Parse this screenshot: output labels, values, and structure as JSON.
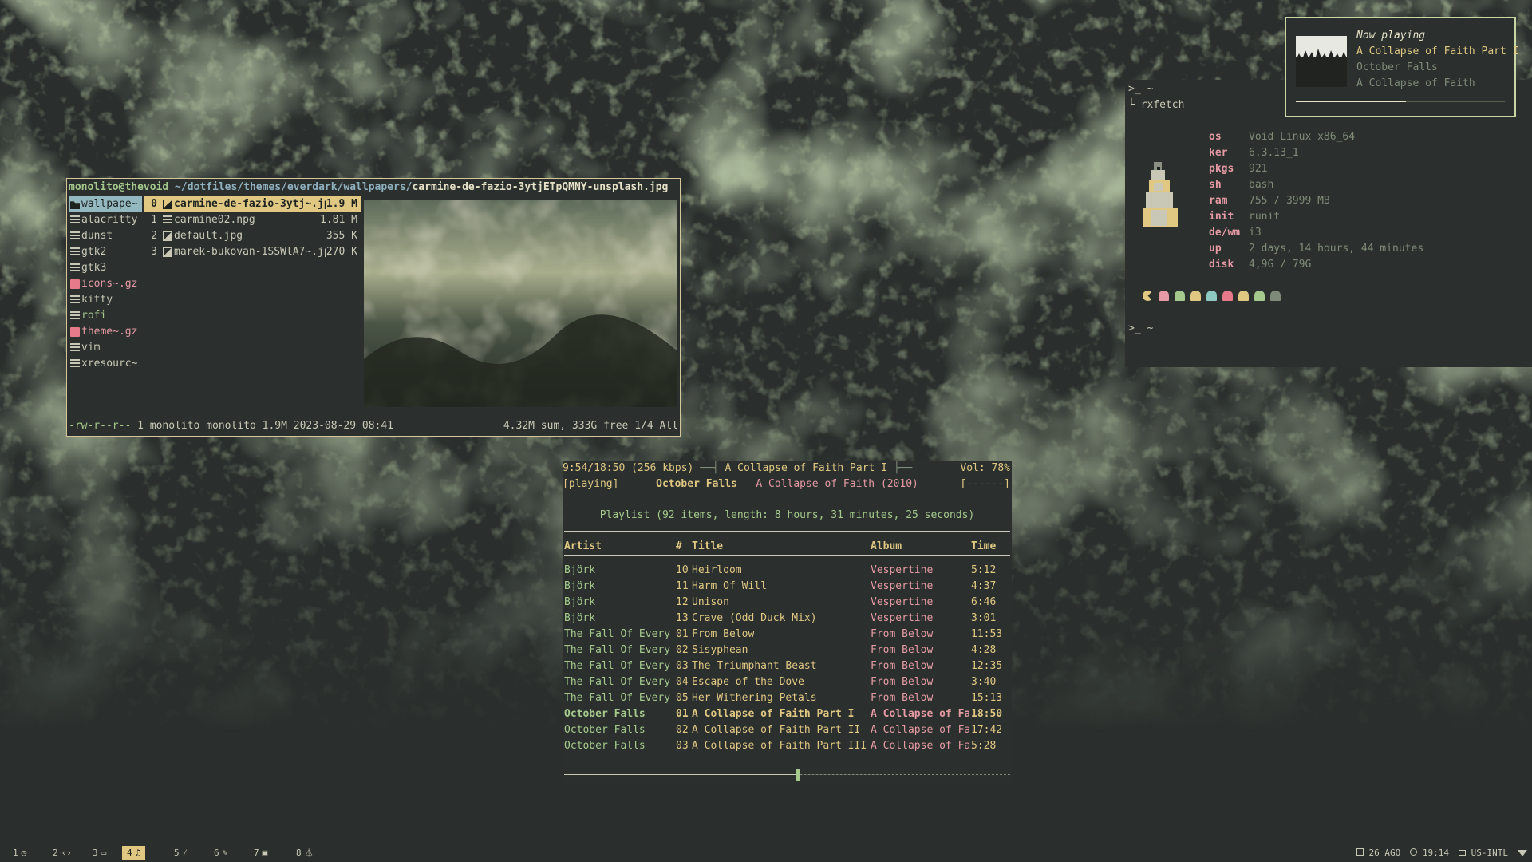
{
  "file_manager": {
    "path_user": "monolito@thevoid",
    "path_dir": " ~/dotfiles/themes/everdark/wallpapers/",
    "path_file": "carmine-de-fazio-3ytjETpQMNY-unsplash.jpg",
    "dirs": [
      {
        "name": "wallpape~",
        "icon": "folder-icon",
        "type": "dir"
      },
      {
        "name": "alacritty",
        "icon": "file-icon",
        "type": "file"
      },
      {
        "name": "dunst",
        "icon": "file-icon",
        "type": "file"
      },
      {
        "name": "gtk2",
        "icon": "file-icon",
        "type": "file"
      },
      {
        "name": "gtk3",
        "icon": "file-icon",
        "type": "file"
      },
      {
        "name": "icons~.gz",
        "icon": "archive-icon",
        "type": "archive"
      },
      {
        "name": "kitty",
        "icon": "file-icon",
        "type": "file"
      },
      {
        "name": "rofi",
        "icon": "file-icon",
        "type": "file"
      },
      {
        "name": "theme~.gz",
        "icon": "archive-icon",
        "type": "archive"
      },
      {
        "name": "vim",
        "icon": "file-icon",
        "type": "file"
      },
      {
        "name": "xresourc~",
        "icon": "file-icon",
        "type": "file"
      }
    ],
    "files": [
      {
        "num": "0",
        "name": "carmine-de-fazio-3ytj~.jpg",
        "size": "1.9 M",
        "icon": "image-icon"
      },
      {
        "num": "1",
        "name": "carmine02.npg",
        "size": "1.81 M",
        "icon": "file-icon"
      },
      {
        "num": "2",
        "name": "default.jpg",
        "size": "355 K",
        "icon": "image-icon"
      },
      {
        "num": "3",
        "name": "marek-bukovan-1SSWlA7~.jpg",
        "size": "270 K",
        "icon": "image-icon"
      }
    ],
    "status_perm": "-rw-r--r--",
    "status_info": " 1 monolito monolito 1.9M 2023-08-29 08:41",
    "status_right": "4.32M sum, 333G free  1/4  All"
  },
  "player": {
    "elapsed": "9:54/18:50 (256 kbps)",
    "current_title": "A Collapse of Faith Part I",
    "volume": "Vol: 78%",
    "state": "[playing]",
    "current_artist": "October Falls",
    "current_album_year": " – A Collapse of Faith (2010)",
    "mode_flags": "[------]",
    "playlist_summary": "Playlist (92 items, length: 8 hours, 31 minutes, 25 seconds)",
    "columns": {
      "artist": "Artist",
      "num": "#",
      "title": "Title",
      "album": "Album",
      "time": "Time"
    },
    "progress": 0.525,
    "tracks": [
      {
        "artist": "Björk",
        "num": "10",
        "title": "Heirloom",
        "album": "Vespertine",
        "time": "5:12",
        "current": false
      },
      {
        "artist": "Björk",
        "num": "11",
        "title": "Harm Of Will",
        "album": "Vespertine",
        "time": "4:37",
        "current": false
      },
      {
        "artist": "Björk",
        "num": "12",
        "title": "Unison",
        "album": "Vespertine",
        "time": "6:46",
        "current": false
      },
      {
        "artist": "Björk",
        "num": "13",
        "title": "Crave (Odd Duck Mix)",
        "album": "Vespertine",
        "time": "3:01",
        "current": false
      },
      {
        "artist": "The Fall Of Every S",
        "num": "01",
        "title": "From Below",
        "album": "From Below",
        "time": "11:53",
        "current": false
      },
      {
        "artist": "The Fall Of Every S",
        "num": "02",
        "title": "Sisyphean",
        "album": "From Below",
        "time": "4:28",
        "current": false
      },
      {
        "artist": "The Fall Of Every S",
        "num": "03",
        "title": "The Triumphant Beast",
        "album": "From Below",
        "time": "12:35",
        "current": false
      },
      {
        "artist": "The Fall Of Every S",
        "num": "04",
        "title": "Escape of the Dove",
        "album": "From Below",
        "time": "3:40",
        "current": false
      },
      {
        "artist": "The Fall Of Every S",
        "num": "05",
        "title": "Her Withering Petals",
        "album": "From Below",
        "time": "15:13",
        "current": false
      },
      {
        "artist": "October Falls",
        "num": "01",
        "title": "A Collapse of Faith Part I",
        "album": "A Collapse of Fai",
        "time": "18:50",
        "current": true
      },
      {
        "artist": "October Falls",
        "num": "02",
        "title": "A Collapse of Faith Part II",
        "album": "A Collapse of Fai",
        "time": "17:42",
        "current": false
      },
      {
        "artist": "October Falls",
        "num": "03",
        "title": "A Collapse of Faith Part III",
        "album": "A Collapse of Fai",
        "time": "5:28",
        "current": false
      }
    ]
  },
  "rxfetch": {
    "prompt": ">_ ~",
    "command": "└ rxfetch",
    "prompt2": ">_ ~",
    "prompt2_branch": "└ ",
    "info": [
      {
        "key": "os",
        "value": "Void Linux x86_64"
      },
      {
        "key": "ker",
        "value": "6.3.13_1"
      },
      {
        "key": "pkgs",
        "value": "921"
      },
      {
        "key": "sh",
        "value": "bash"
      },
      {
        "key": "ram",
        "value": "755 / 3999 MB"
      },
      {
        "key": "init",
        "value": "runit"
      },
      {
        "key": "de/wm",
        "value": "i3"
      },
      {
        "key": "up",
        "value": "2 days, 14 hours, 44 minutes"
      },
      {
        "key": "disk",
        "value": "4,9G / 79G"
      }
    ],
    "palette": [
      "#e0c883",
      "#e69aa5",
      "#a5c98c",
      "#e0c883",
      "#8fc8c2",
      "#e67a8a",
      "#e0c883",
      "#a5c98c",
      "#7f8b79"
    ]
  },
  "notification": {
    "heading": "Now playing",
    "title": "A Collapse of Faith Part I",
    "artist": "October Falls",
    "album": "A Collapse of Faith",
    "progress": 0.525
  },
  "bar": {
    "workspaces": [
      {
        "num": "1",
        "icon": "clock-icon",
        "active": false
      },
      {
        "num": "2",
        "icon": "code-icon",
        "active": false
      },
      {
        "num": "3",
        "icon": "folder-icon",
        "active": false
      },
      {
        "num": "4",
        "icon": "music-icon",
        "active": true
      },
      {
        "num": "5",
        "icon": "brush-icon",
        "active": false
      },
      {
        "num": "6",
        "icon": "pencil-icon",
        "active": false
      },
      {
        "num": "7",
        "icon": "terminal-icon",
        "active": false
      },
      {
        "num": "8",
        "icon": "flask-icon",
        "active": false
      }
    ],
    "date": "26 AGO",
    "time": "19:14",
    "keyboard": "US-INTL"
  },
  "colors": {
    "background": "#2a2f2d",
    "foreground": "#c9c8b6",
    "green": "#a5c98c",
    "pink": "#e69aa5",
    "yellow": "#e0c883",
    "cyan": "#8fb0bf"
  }
}
